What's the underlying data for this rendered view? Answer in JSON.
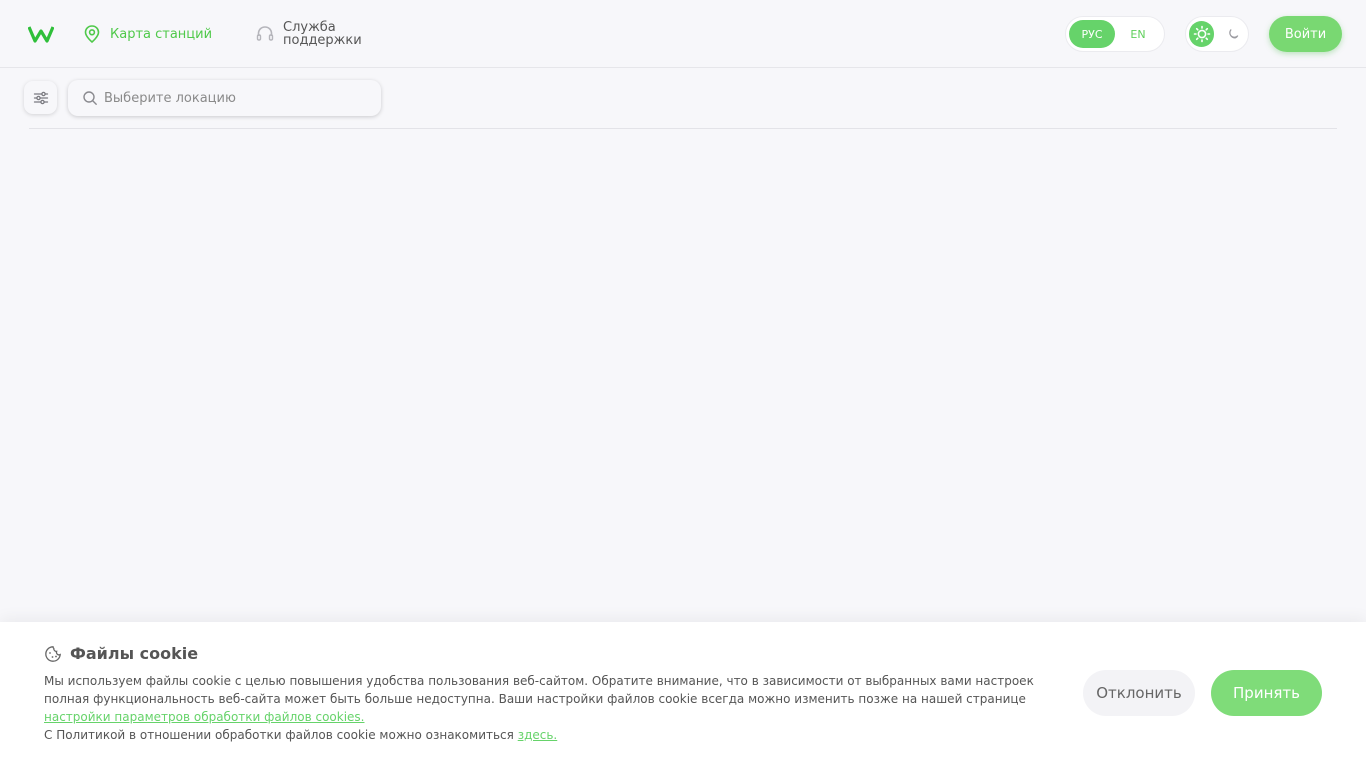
{
  "header": {
    "nav_map_label": "Карта станций",
    "nav_support_label": "Служба поддержки",
    "lang_ru": "РУС",
    "lang_en": "EN",
    "login_label": "Войти"
  },
  "search": {
    "placeholder": "Выберите локацию"
  },
  "cookie": {
    "title": "Файлы cookie",
    "text_1": "Мы используем файлы cookie с целью повышения удобства пользования веб-сайтом. Обратите внимание, что в зависимости от выбранных вами настроек полная функциональность веб-сайта может быть больше недоступна. Ваши настройки файлов cookie всегда можно изменить позже на нашей странице ",
    "settings_link": "настройки параметров обработки файлов cookies.",
    "text_2": "С Политикой в отношении обработки файлов cookie можно ознакомиться ",
    "policy_link": "здесь.",
    "decline_label": "Отклонить",
    "accept_label": "Принять"
  },
  "colors": {
    "accent": "#66d36a",
    "background": "#f7f7fa"
  },
  "icons": {
    "logo": "brand-logo",
    "map": "map-pin-icon",
    "support": "headset-icon",
    "sun": "sun-icon",
    "moon": "moon-icon",
    "filter": "filter-sliders-icon",
    "search": "search-icon",
    "cookie": "cookie-icon"
  }
}
